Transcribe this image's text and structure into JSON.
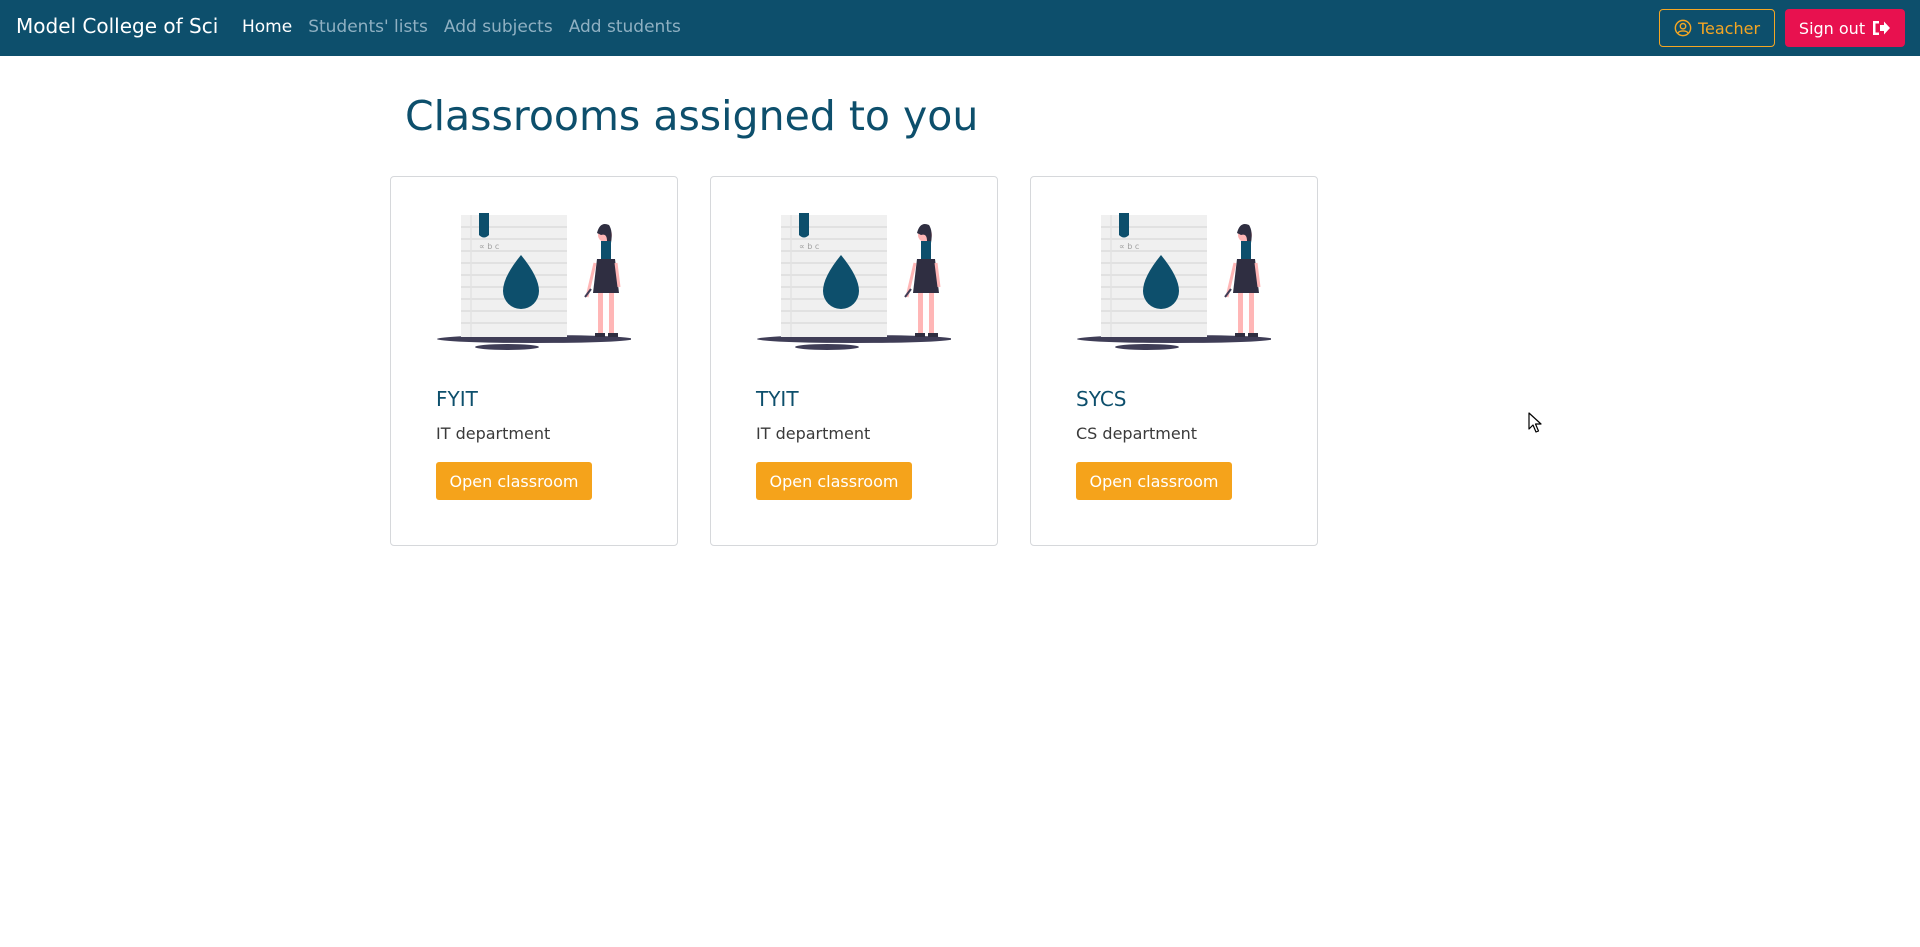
{
  "navbar": {
    "brand": "Model College of Sci",
    "links": [
      {
        "label": "Home",
        "active": true
      },
      {
        "label": "Students' lists",
        "active": false
      },
      {
        "label": "Add subjects",
        "active": false
      },
      {
        "label": "Add students",
        "active": false
      }
    ],
    "teacher_label": "Teacher",
    "signout_label": "Sign out"
  },
  "main": {
    "title": "Classrooms assigned to you",
    "classrooms": [
      {
        "name": "FYIT",
        "department": "IT department",
        "button_label": "Open classroom"
      },
      {
        "name": "TYIT",
        "department": "IT department",
        "button_label": "Open classroom"
      },
      {
        "name": "SYCS",
        "department": "CS department",
        "button_label": "Open classroom"
      }
    ]
  },
  "icons": {
    "teacher": "user-circle-icon",
    "signout": "sign-out-icon",
    "card_image": "classroom-illustration"
  },
  "colors": {
    "navbar_bg": "#0d4f6c",
    "accent": "#f5a31b",
    "signout": "#e8114f",
    "title": "#0d4f6c"
  }
}
